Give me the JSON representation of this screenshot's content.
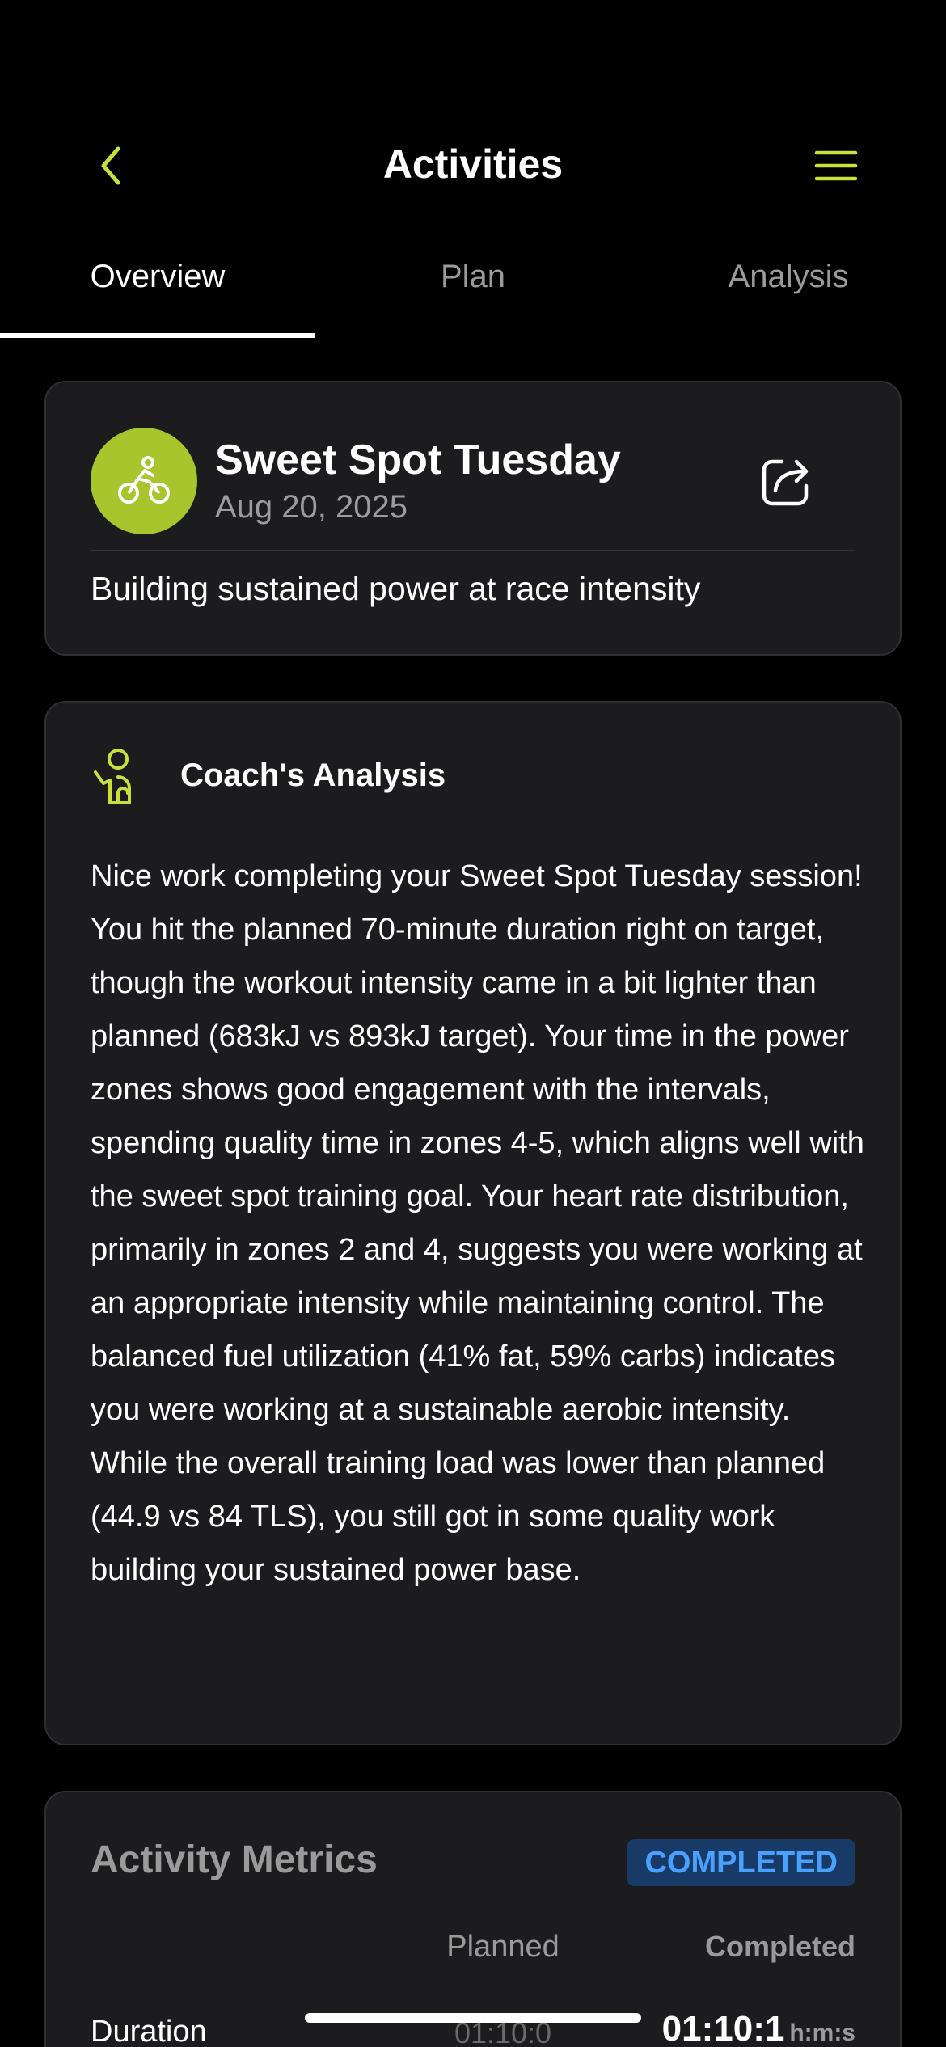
{
  "header": {
    "title": "Activities",
    "back_icon": "chevron-left-icon",
    "menu_icon": "hamburger-menu-icon",
    "accent_color": "#c9e03a"
  },
  "tabs": [
    {
      "label": "Overview",
      "active": true
    },
    {
      "label": "Plan",
      "active": false
    },
    {
      "label": "Analysis",
      "active": false
    }
  ],
  "activity": {
    "title": "Sweet Spot Tuesday",
    "date": "Aug 20, 2025",
    "description": "Building sustained power at race intensity",
    "sport_icon": "cycling-icon",
    "sport_color": "#a9c52e",
    "share_icon": "share-icon"
  },
  "coach": {
    "title": "Coach's Analysis",
    "icon": "coach-icon",
    "body": "Nice work completing your Sweet Spot Tuesday session! You hit the planned 70-minute duration right on target, though the workout intensity came in a bit lighter than planned (683kJ vs 893kJ target). Your time in the power zones shows good engagement with the intervals, spending quality time in zones 4-5, which aligns well with the sweet spot training goal. Your heart rate distribution, primarily in zones 2 and 4, suggests you were working at an appropriate intensity while maintaining control. The balanced fuel utilization (41% fat, 59% carbs) indicates you were working at a sustainable aerobic intensity. While the overall training load was lower than planned (44.9 vs 84 TLS), you still got in some quality work building your sustained power base."
  },
  "metrics": {
    "title": "Activity Metrics",
    "status": "COMPLETED",
    "status_color": "#4aa0ff",
    "col_planned": "Planned",
    "col_completed": "Completed",
    "rows": [
      {
        "label": "Duration",
        "planned": "01:10:0",
        "completed": "01:10:1",
        "unit": "h:m:s"
      }
    ]
  }
}
